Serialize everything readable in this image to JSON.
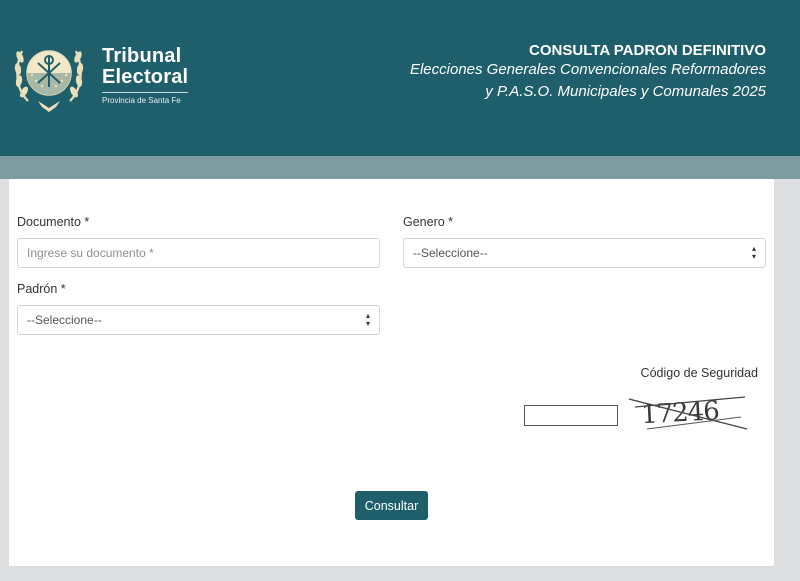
{
  "header": {
    "logo": {
      "line1": "Tribunal",
      "line2": "Electoral",
      "line3": "Provincia de Santa Fe"
    },
    "title": "CONSULTA PADRON DEFINITIVO",
    "subtitle_line1": "Elecciones Generales Convencionales Reformadores",
    "subtitle_line2": "y P.A.S.O. Municipales y Comunales 2025"
  },
  "form": {
    "documento": {
      "label": "Documento *",
      "placeholder": "Ingrese su documento *",
      "value": ""
    },
    "genero": {
      "label": "Genero *",
      "selected": "--Seleccione--"
    },
    "padron": {
      "label": "Padrón *",
      "selected": "--Seleccione--"
    },
    "captcha": {
      "label": "Código de Seguridad",
      "code": "17246",
      "value": ""
    },
    "submit_label": "Consultar"
  },
  "colors": {
    "header_bg": "#1f5f6b",
    "subbar_bg": "#7d9ca2",
    "page_bg": "#dcdedf",
    "button_bg": "#1f5f6b"
  }
}
